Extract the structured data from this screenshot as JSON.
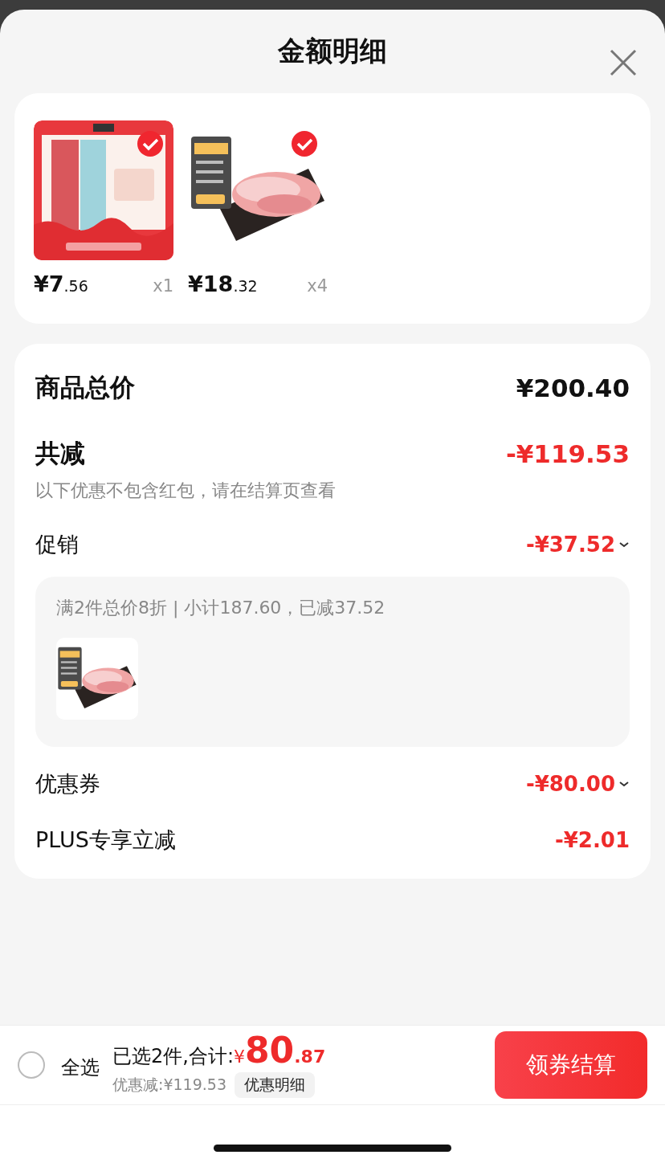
{
  "title": "金额明细",
  "products": [
    {
      "price_main": "¥7",
      "price_cents": ".56",
      "quantity": "x1",
      "selected": true
    },
    {
      "price_main": "¥18",
      "price_cents": ".32",
      "quantity": "x4",
      "selected": true
    }
  ],
  "total": {
    "label": "商品总价",
    "amount": "¥200.40"
  },
  "reduction": {
    "label": "共减",
    "amount": "-¥119.53",
    "note": "以下优惠不包含红包，请在结算页查看"
  },
  "discounts": [
    {
      "kind": "dropdown",
      "label": "促销",
      "amount": "-¥37.52",
      "detail": {
        "text": "满2件总价8折 | 小计187.60，已减37.52"
      }
    },
    {
      "kind": "dropdown",
      "label": "优惠券",
      "amount": "-¥80.00"
    },
    {
      "kind": "plain",
      "label": "PLUS专享立减",
      "amount": "-¥2.01"
    }
  ],
  "bottom_bar": {
    "select_all": {
      "label": "全选",
      "checked": false
    },
    "summary": "已选2件,合计:",
    "currency": "¥",
    "total_main": "80",
    "total_cents": ".87",
    "saving": "优惠减:¥119.53",
    "detail_button": "优惠明细",
    "checkout_button": "领券结算"
  }
}
